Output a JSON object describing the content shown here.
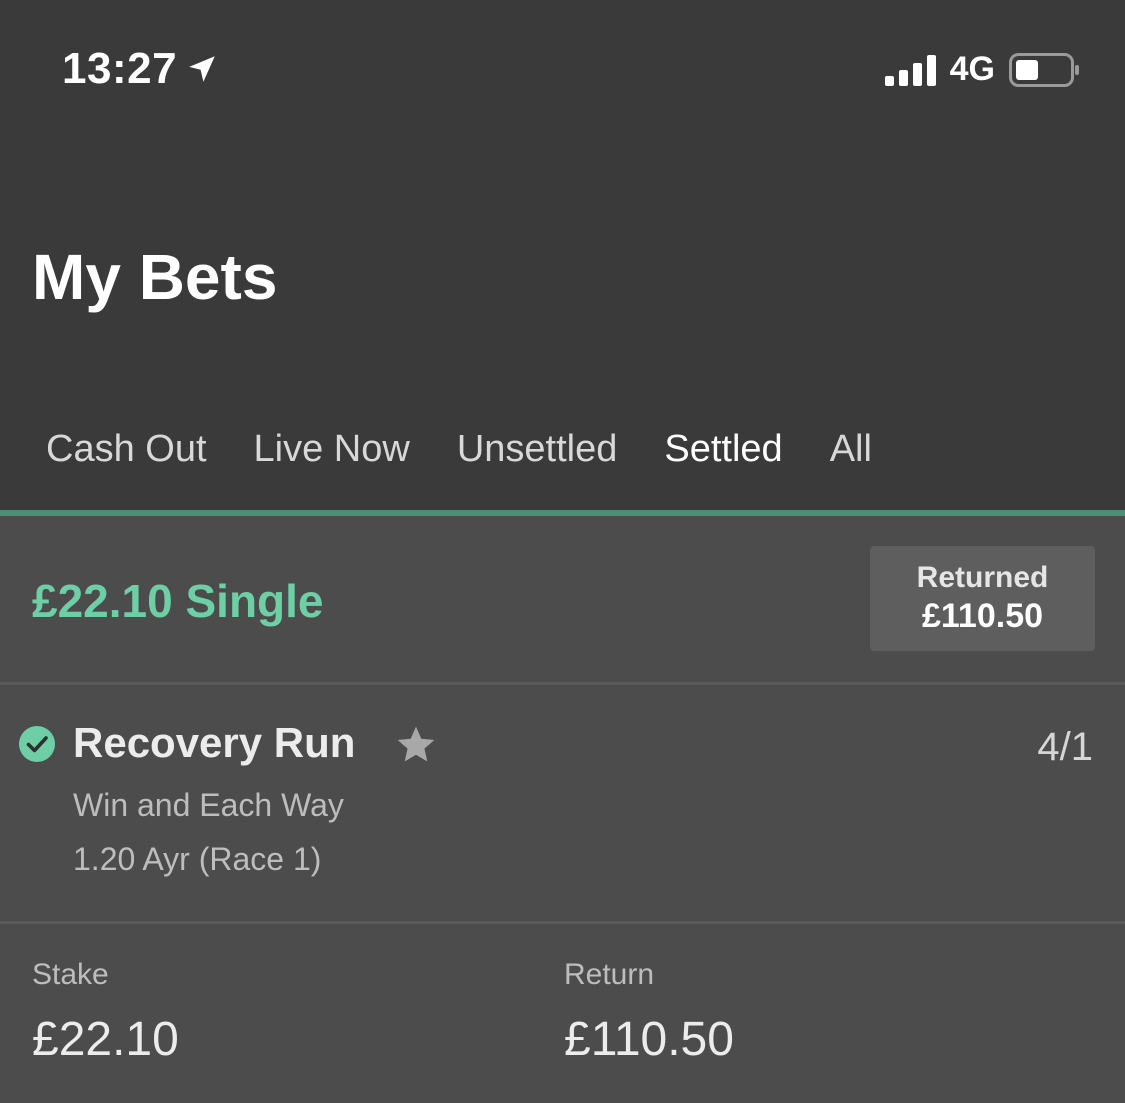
{
  "status_bar": {
    "time": "13:27",
    "network": "4G",
    "icons": [
      "location-arrow-icon",
      "signal-bars-icon",
      "battery-icon"
    ]
  },
  "page": {
    "title": "My Bets"
  },
  "tabs": [
    {
      "label": "Cash Out",
      "active": false
    },
    {
      "label": "Live Now",
      "active": false
    },
    {
      "label": "Unsettled",
      "active": false
    },
    {
      "label": "Settled",
      "active": true
    },
    {
      "label": "All",
      "active": false
    }
  ],
  "bet": {
    "title": "£22.10 Single",
    "returned_label": "Returned",
    "returned_amount": "£110.50",
    "selection": {
      "name": "Recovery Run",
      "odds": "4/1",
      "market": "Win and Each Way",
      "event": "1.20 Ayr (Race 1)",
      "status_icon": "check-circle-icon",
      "favourite_icon": "star-icon"
    },
    "stake_label": "Stake",
    "stake_value": "£22.10",
    "return_label": "Return",
    "return_value": "£110.50"
  },
  "colors": {
    "accent_green": "#6ecfa6",
    "tab_line": "#4b8f77",
    "header_bg": "#3a3a3a",
    "body_bg": "#4c4c4c"
  }
}
